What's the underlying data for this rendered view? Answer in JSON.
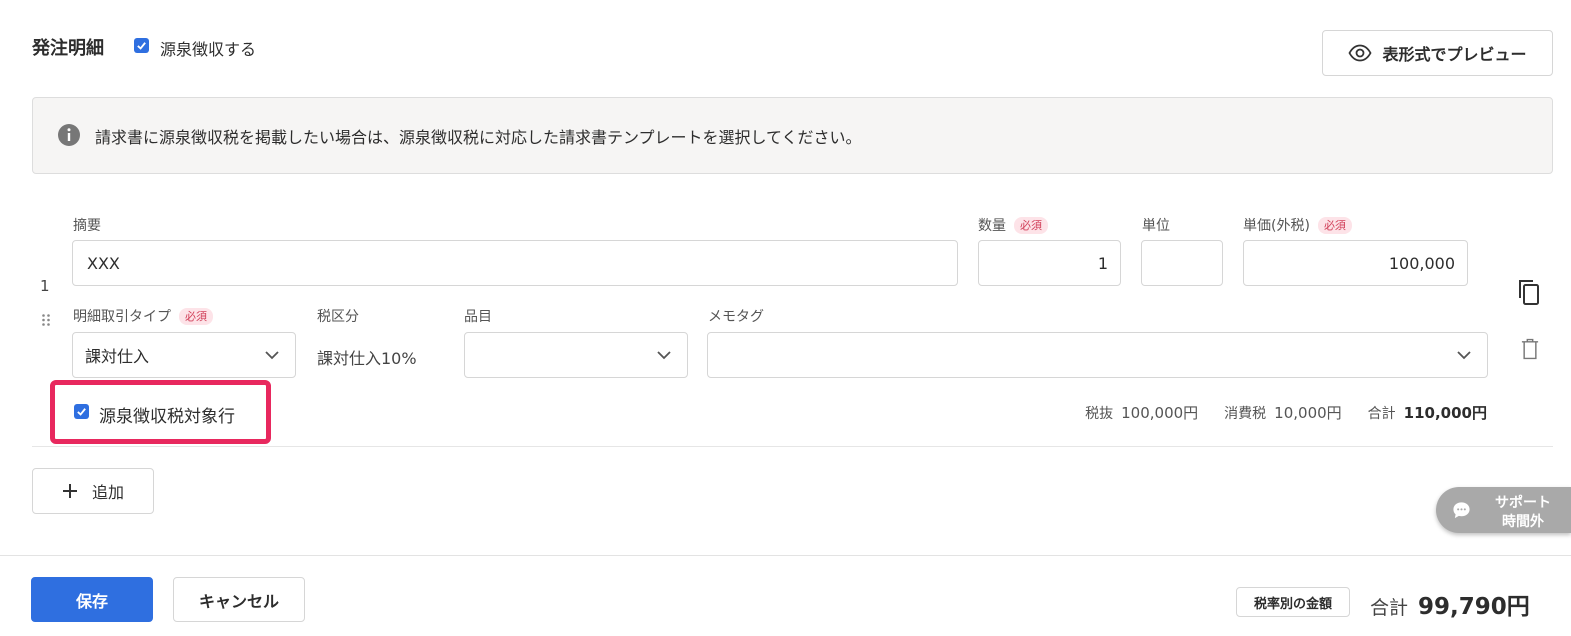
{
  "header": {
    "title": "発注明細",
    "withholding_label": "源泉徴収する",
    "preview_label": "表形式でプレビュー"
  },
  "notice": {
    "text": "請求書に源泉徴収税を掲載したい場合は、源泉徴収税に対応した請求書テンプレートを選択してください。"
  },
  "line_item": {
    "index": "1",
    "summary_label": "摘要",
    "summary_value": "XXX",
    "quantity_label": "数量",
    "quantity_value": "1",
    "unit_label": "単位",
    "unit_value": "",
    "unit_price_label": "単価(外税)",
    "unit_price_value": "100,000",
    "required_badge": "必須",
    "transaction_type_label": "明細取引タイプ",
    "transaction_type_value": "課対仕入",
    "tax_category_label": "税区分",
    "tax_category_value": "課対仕入10%",
    "item_label": "品目",
    "item_value": "",
    "memo_tag_label": "メモタグ",
    "memo_tag_value": "",
    "withholding_row_label": "源泉徴収税対象行",
    "tax_excluded_label": "税抜",
    "tax_excluded_value": "100,000円",
    "consumption_tax_label": "消費税",
    "consumption_tax_value": "10,000円",
    "total_label": "合計",
    "total_value": "110,000円"
  },
  "add_button": {
    "label": "追加"
  },
  "support": {
    "line1": "サポート",
    "line2": "時間外"
  },
  "footer": {
    "save_label": "保存",
    "cancel_label": "キャンセル",
    "tax_rate_button": "税率別の金額",
    "total_label": "合計",
    "total_value": "99,790円"
  },
  "colors": {
    "primary": "#2f6fe0",
    "highlight": "#e8285e",
    "required_text": "#d1405a",
    "required_bg": "#fde3e8"
  }
}
